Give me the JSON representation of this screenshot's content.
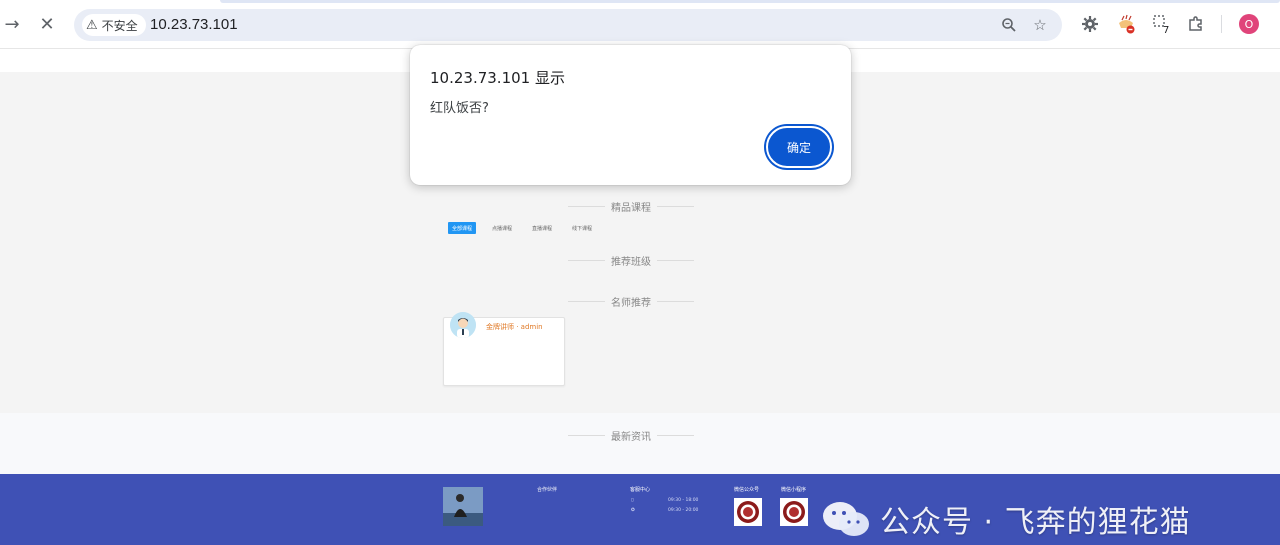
{
  "browser": {
    "security_label": "不安全",
    "url": "10.23.73.101",
    "profile_initial": "O",
    "extension_badge": "7",
    "icons": [
      "forward-icon",
      "close-icon",
      "warning-icon",
      "zoom-icon",
      "star-icon",
      "gear-extension-icon",
      "noodle-extension-icon",
      "counter-extension-icon",
      "puzzle-icon"
    ]
  },
  "alert": {
    "title": "10.23.73.101 显示",
    "message": "红队饭否?",
    "ok_label": "确定"
  },
  "page": {
    "sections": {
      "courses": "精品课程",
      "classes": "推荐班级",
      "teachers": "名师推荐",
      "news": "最新资讯"
    },
    "course_tabs": [
      {
        "label": "全部课程",
        "active": true
      },
      {
        "label": "点播课程",
        "active": false
      },
      {
        "label": "直播课程",
        "active": false
      },
      {
        "label": "线下课程",
        "active": false
      }
    ],
    "teacher": {
      "name": "金牌讲师 · admin"
    }
  },
  "footer": {
    "partners": "合作伙伴",
    "service": "客服中心",
    "hours": [
      "09:30 - 18:00",
      "09:30 - 20:00"
    ],
    "wechat_account": "微信公众号",
    "mini_program": "微信小程序"
  },
  "watermark": {
    "text": "公众号 · 飞奔的狸花猫"
  },
  "colors": {
    "footer": "#3f51b5",
    "primary_button": "#0b57d0",
    "tab_active": "#2196f3",
    "teacher_name": "#e07a28"
  }
}
